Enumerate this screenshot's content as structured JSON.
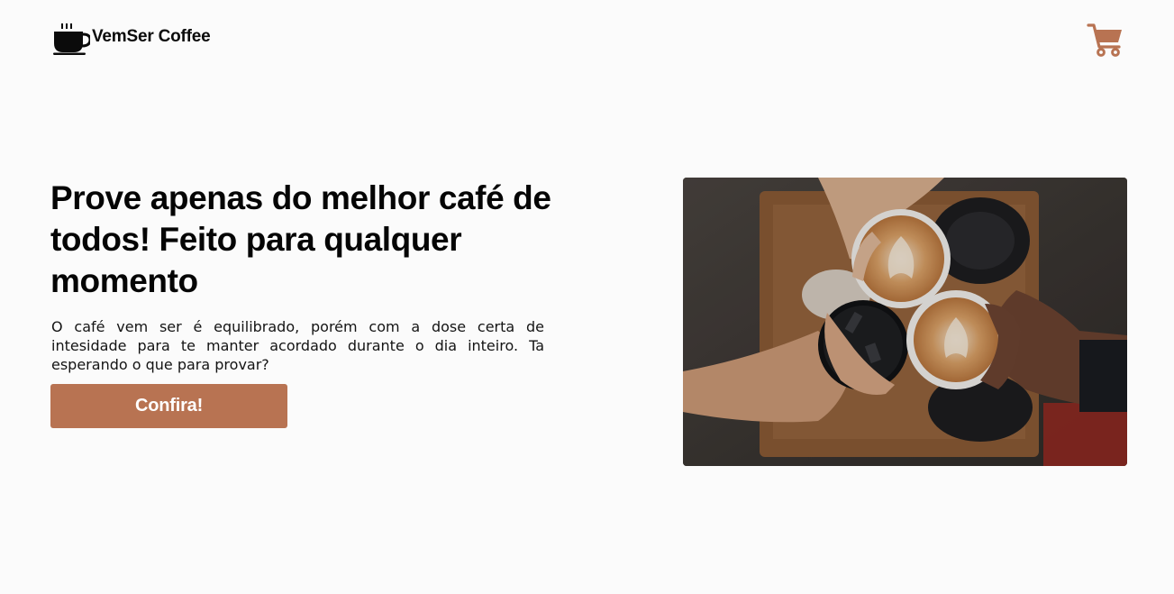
{
  "header": {
    "brand_name": "VemSer Coffee",
    "logo_icon": "coffee-cup-icon",
    "cart_icon": "shopping-cart-icon"
  },
  "hero": {
    "title": "Prove apenas do melhor café de todos! Feito para qualquer momento",
    "description": "O café vem ser é equilibrado, porém com a dose certa de intesidade para te manter acordado durante o dia inteiro. Ta esperando o que para provar?",
    "cta_label": "Confira!",
    "image_subject": "hands toasting with three cups of coffee over a wooden table"
  },
  "colors": {
    "accent": "#b87352",
    "background": "#fbfbfb",
    "text": "#0b0b0b"
  }
}
